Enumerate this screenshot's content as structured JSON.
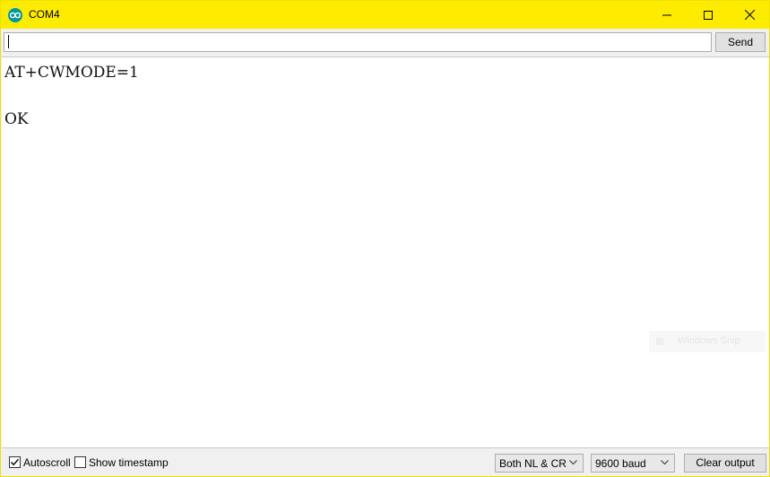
{
  "window": {
    "title": "COM4",
    "titlebar_color": "#fdec00",
    "controls": [
      "minimize-icon",
      "maximize-icon",
      "close-icon"
    ]
  },
  "send_row": {
    "input_value": "",
    "send_label": "Send"
  },
  "output": {
    "lines": [
      "AT+CWMODE=1",
      "OK"
    ]
  },
  "overlay": {
    "text": "Windows Snip"
  },
  "bottom_bar": {
    "autoscroll_label": "Autoscroll",
    "autoscroll_checked": true,
    "timestamp_label": "Show timestamp",
    "timestamp_checked": false,
    "line_ending": "Both NL & CR",
    "baud_rate": "9600 baud",
    "clear_label": "Clear output"
  }
}
